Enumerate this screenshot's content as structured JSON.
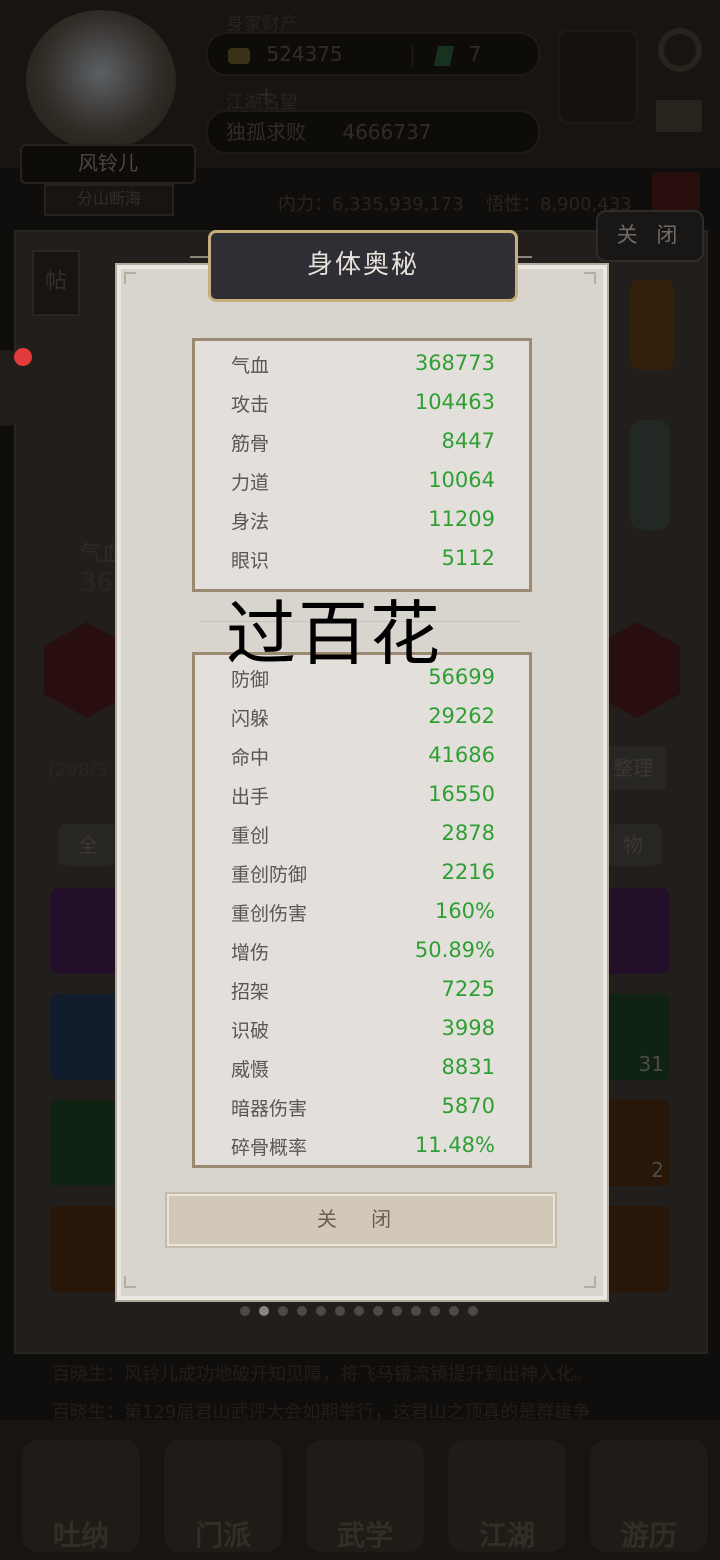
{
  "header": {
    "avatar_name": "风铃儿",
    "avatar_title": "分山断海",
    "wealth_label": "身家财产",
    "gold": "524375",
    "jade": "7",
    "plus": "+",
    "reputation_label": "江湖名望",
    "rank_title": "独孤求败",
    "reputation_value": "4666737",
    "internal_power": "内力：6,335,939,173",
    "insight": "悟性：8,900,433"
  },
  "background_panel": {
    "close_label": "关 闭",
    "post_icon_label": "帖",
    "hp_partial": "气血",
    "hp_value_partial": "36",
    "bag_count_partial": "(298/3",
    "tidy_label": "整理",
    "filter_all": "全",
    "filter_item": "物",
    "badge_31": "31",
    "badge_2": "2"
  },
  "modal": {
    "title": "身体奥秘",
    "top_stats": [
      {
        "name": "气血",
        "value": "368773"
      },
      {
        "name": "攻击",
        "value": "104463"
      },
      {
        "name": "筋骨",
        "value": "8447"
      },
      {
        "name": "力道",
        "value": "10064"
      },
      {
        "name": "身法",
        "value": "11209"
      },
      {
        "name": "眼识",
        "value": "5112"
      }
    ],
    "overlay_caption": "过百花",
    "bottom_stats": [
      {
        "name": "防御",
        "value": "56699"
      },
      {
        "name": "闪躲",
        "value": "29262"
      },
      {
        "name": "命中",
        "value": "41686"
      },
      {
        "name": "出手",
        "value": "16550"
      },
      {
        "name": "重创",
        "value": "2878"
      },
      {
        "name": "重创防御",
        "value": "2216"
      },
      {
        "name": "重创伤害",
        "value": "160%"
      },
      {
        "name": "增伤",
        "value": "50.89%"
      },
      {
        "name": "招架",
        "value": "7225"
      },
      {
        "name": "识破",
        "value": "3998"
      },
      {
        "name": "威慑",
        "value": "8831"
      },
      {
        "name": "暗器伤害",
        "value": "5870"
      },
      {
        "name": "碎骨概率",
        "value": "11.48%"
      }
    ],
    "close_label": "关 闭",
    "page_dots": 13,
    "active_dot": 1
  },
  "chat": {
    "line1": "百晓生：风铃儿成功地破开知见障，将飞马镜流镜提升到出神入化。",
    "line2": "百晓生：第129届君山武评大会如期举行，这君山之顶真的是群雄争"
  },
  "bottom_nav": [
    "吐纳",
    "门派",
    "武学",
    "江湖",
    "游历"
  ]
}
